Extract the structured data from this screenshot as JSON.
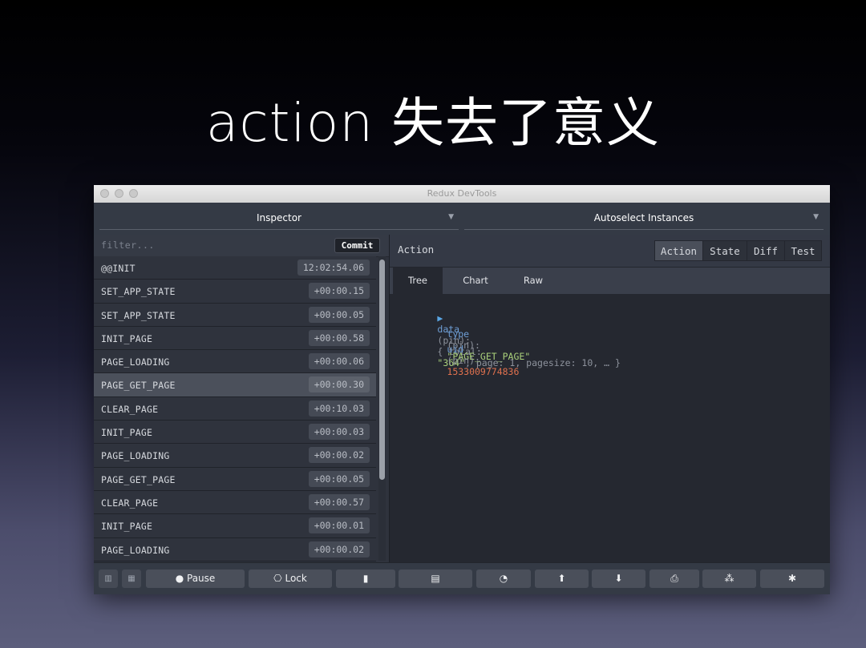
{
  "slide": {
    "title": "action 失去了意义"
  },
  "window": {
    "title": "Redux DevTools"
  },
  "monitors": {
    "inspector": "Inspector",
    "instances": "Autoselect Instances"
  },
  "actions": {
    "filter_placeholder": "filter...",
    "commit_label": "Commit",
    "items": [
      {
        "name": "@@INIT",
        "time": "12:02:54.06"
      },
      {
        "name": "SET_APP_STATE",
        "time": "+00:00.15"
      },
      {
        "name": "SET_APP_STATE",
        "time": "+00:00.05"
      },
      {
        "name": "INIT_PAGE",
        "time": "+00:00.58"
      },
      {
        "name": "PAGE_LOADING",
        "time": "+00:00.06"
      },
      {
        "name": "PAGE_GET_PAGE",
        "time": "+00:00.30"
      },
      {
        "name": "CLEAR_PAGE",
        "time": "+00:10.03"
      },
      {
        "name": "INIT_PAGE",
        "time": "+00:00.03"
      },
      {
        "name": "PAGE_LOADING",
        "time": "+00:00.02"
      },
      {
        "name": "PAGE_GET_PAGE",
        "time": "+00:00.05"
      },
      {
        "name": "CLEAR_PAGE",
        "time": "+00:00.57"
      },
      {
        "name": "INIT_PAGE",
        "time": "+00:00.01"
      },
      {
        "name": "PAGE_LOADING",
        "time": "+00:00.02"
      }
    ],
    "selected_index": 5
  },
  "detail": {
    "title": "Action",
    "tabs": [
      "Action",
      "State",
      "Diff",
      "Test"
    ],
    "active_tab": "Action",
    "subtabs": [
      "Tree",
      "Chart",
      "Raw"
    ],
    "active_subtab": "Tree",
    "tree": {
      "expander": "▶",
      "data_key": "data",
      "data_meta": "(pin):",
      "data_open": "{ ",
      "data_total_key": "total:",
      "data_total_val": "\"364\"",
      "data_rest": ", page: 1, pagesize: 10, … }",
      "type_key": "type",
      "type_meta": "(pin):",
      "type_val": "\"PAGE_GET_PAGE\"",
      "uid_key": "uid",
      "uid_meta": "(pin):",
      "uid_val": "1533009774836"
    }
  },
  "bottombar": {
    "pause_label": "Pause",
    "lock_label": "Lock",
    "pause_icon": "●",
    "lock_icon": "⎔",
    "icons": {
      "dispatch": "▮",
      "keyboard": "▤",
      "slider": "◔",
      "import": "⬆",
      "export": "⬇",
      "print": "⎙",
      "remote": "⁂",
      "settings": "✱"
    }
  }
}
